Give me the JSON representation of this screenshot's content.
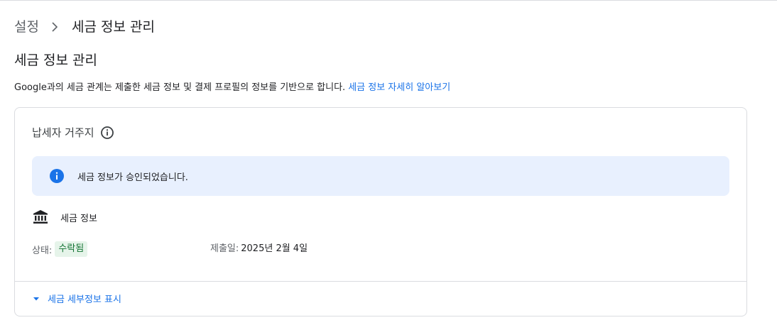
{
  "breadcrumb": {
    "parent": "설정",
    "current": "세금 정보 관리"
  },
  "page_title": "세금 정보 관리",
  "intro": {
    "text": "Google과의 세금 관계는 제출한 세금 정보 및 결제 프로필의 정보를 기반으로 합니다.",
    "link": "세금 정보 자세히 알아보기"
  },
  "card": {
    "header": "납세자 거주지",
    "notice": "세금 정보가 승인되었습니다.",
    "tax_info_label": "세금 정보",
    "status_label": "상태:",
    "status_value": "수락됨",
    "submitted_label": "제출일:",
    "submitted_date": "2025년 2월 4일",
    "details_toggle": "세금 세부정보 표시"
  },
  "colors": {
    "accent": "#1a73e8",
    "notice_bg": "#e8f0fe",
    "status_bg": "#e6f4ea",
    "status_text": "#137333"
  },
  "icons": [
    "chevron-right-icon",
    "info-outline-icon",
    "info-filled-icon",
    "bank-icon",
    "caret-down-icon"
  ]
}
